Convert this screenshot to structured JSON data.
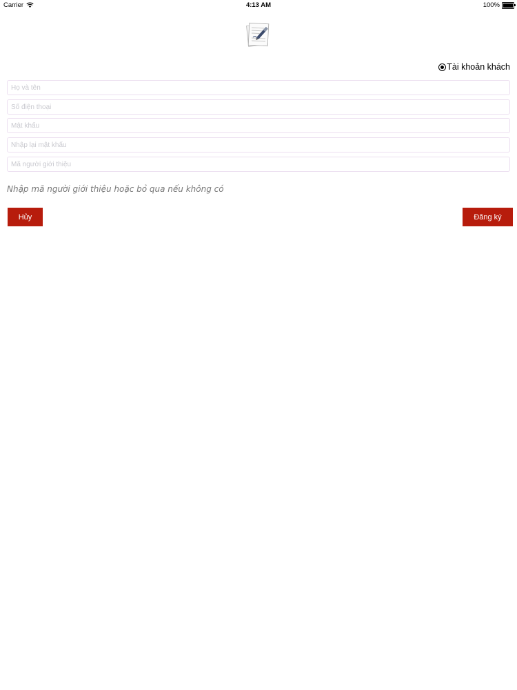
{
  "status_bar": {
    "carrier": "Carrier",
    "time": "4:13 AM",
    "battery": "100%",
    "icons": [
      "wifi-icon",
      "battery-icon"
    ]
  },
  "logo": {
    "icon": "document-pen-icon"
  },
  "guest_option": {
    "label": "Tài khoản khách",
    "selected": true
  },
  "form": {
    "fullname_placeholder": "Họ và tên",
    "phone_placeholder": "Số điện thoại",
    "password_placeholder": "Mật khẩu",
    "confirm_password_placeholder": "Nhập lại mật khẩu",
    "referral_placeholder": "Mã người giới thiệu",
    "hint": "Nhập mã người giới thiệu hoặc bỏ qua nếu không có"
  },
  "buttons": {
    "cancel_label": "Hủy",
    "register_label": "Đăng ký"
  },
  "colors": {
    "accent": "#b71c0c",
    "field_border": "#ecdff0",
    "placeholder": "#c9c9cf",
    "hint": "#777777"
  }
}
